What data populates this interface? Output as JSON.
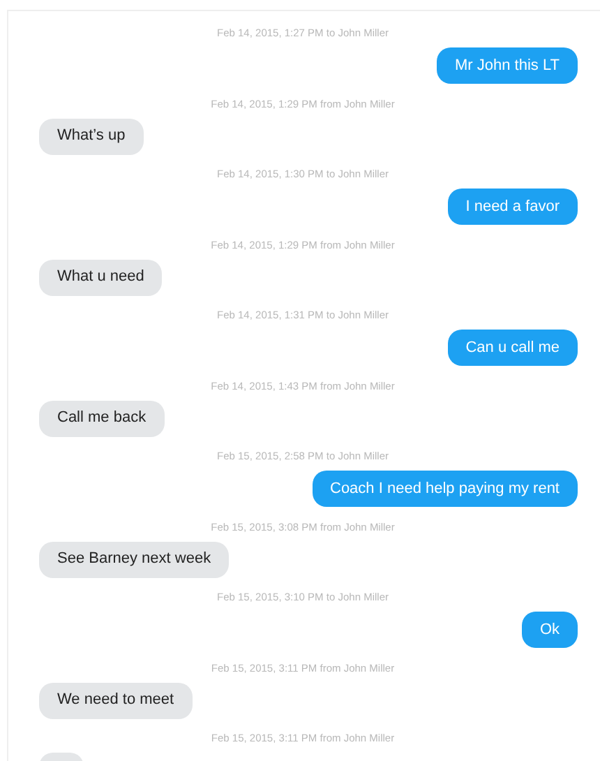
{
  "messages": [
    {
      "timestamp": "Feb 14, 2015, 1:27 PM to John Miller",
      "kind": "sent",
      "text": "Mr John this LT"
    },
    {
      "timestamp": "Feb 14, 2015, 1:29 PM from John Miller",
      "kind": "received",
      "text": "What’s up"
    },
    {
      "timestamp": "Feb 14, 2015, 1:30 PM to John Miller",
      "kind": "sent",
      "text": "I need a favor"
    },
    {
      "timestamp": "Feb 14, 2015, 1:29 PM from John Miller",
      "kind": "received",
      "text": "What u need"
    },
    {
      "timestamp": "Feb 14, 2015, 1:31 PM to John Miller",
      "kind": "sent",
      "text": "Can u call me"
    },
    {
      "timestamp": "Feb 14, 2015, 1:43 PM from John Miller",
      "kind": "received",
      "text": "Call me back"
    },
    {
      "timestamp": "Feb 15, 2015, 2:58 PM to John Miller",
      "kind": "sent",
      "text": "Coach I need help paying my rent"
    },
    {
      "timestamp": "Feb 15, 2015, 3:08 PM from John Miller",
      "kind": "received",
      "text": "See Barney next week"
    },
    {
      "timestamp": "Feb 15, 2015, 3:10 PM to John Miller",
      "kind": "sent",
      "text": "Ok"
    },
    {
      "timestamp": "Feb 15, 2015, 3:11 PM from John Miller",
      "kind": "received",
      "text": "We need to meet"
    },
    {
      "timestamp": "Feb 15, 2015, 3:11 PM from John Miller",
      "kind": "received"
    }
  ]
}
